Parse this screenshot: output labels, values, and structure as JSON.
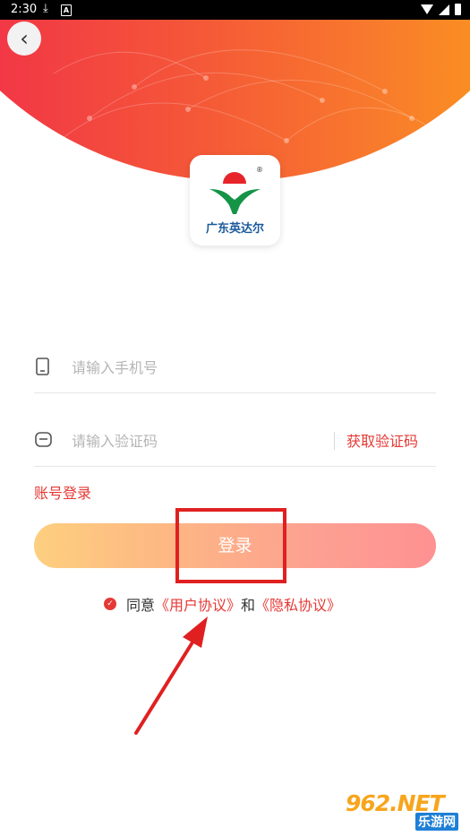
{
  "status_bar": {
    "time": "2:30"
  },
  "brand": {
    "logo_text": "广东英达尔",
    "registered_mark": "®"
  },
  "form": {
    "phone_placeholder": "请输入手机号",
    "code_placeholder": "请输入验证码",
    "get_code_label": "获取验证码",
    "account_login_label": "账号登录",
    "login_button_label": "登录"
  },
  "agreement": {
    "prefix": "同意",
    "user_agreement": "《用户协议》",
    "conjunction": "和",
    "privacy_policy": "《隐私协议》"
  },
  "watermark": {
    "main": "962.NET",
    "sub": "乐游网"
  },
  "colors": {
    "accent": "#e53935",
    "hero_start": "#f0274d",
    "hero_end": "#fda415",
    "button_start": "#fdcf7f",
    "button_end": "#fe9192",
    "annotation": "#e02020"
  },
  "icons": {
    "back": "chevron-left-icon",
    "phone": "phone-icon",
    "code": "message-icon",
    "check": "check-circle-icon"
  }
}
